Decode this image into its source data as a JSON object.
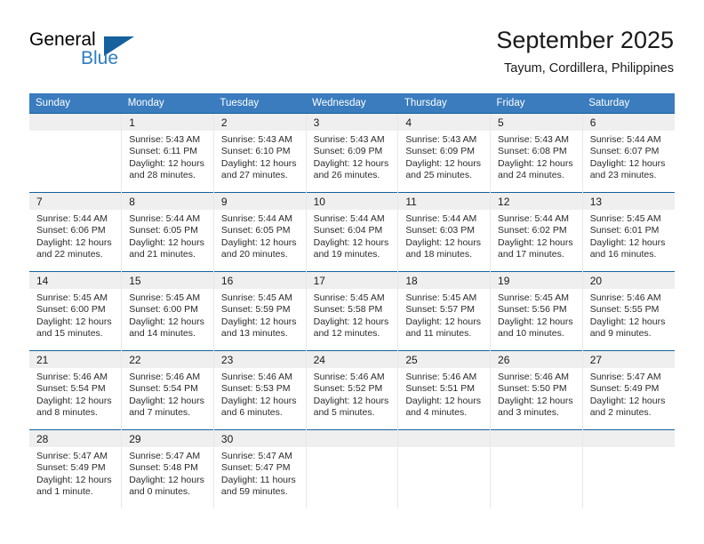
{
  "brand": {
    "name_part1": "General",
    "name_part2": "Blue",
    "logo_icon": "triangle-logo-icon",
    "color_primary": "#15619e",
    "color_secondary": "#2e7dc0"
  },
  "header": {
    "title": "September 2025",
    "subtitle": "Tayum, Cordillera, Philippines"
  },
  "theme": {
    "header_row_bg": "#3a7cbe",
    "day_band_bg": "#efefef",
    "row_divider": "#15619e",
    "column_divider": "#e8e8e8"
  },
  "calendar": {
    "weekday_headers": [
      "Sunday",
      "Monday",
      "Tuesday",
      "Wednesday",
      "Thursday",
      "Friday",
      "Saturday"
    ],
    "weeks": [
      [
        {
          "day": "",
          "sunrise": "",
          "sunset": "",
          "daylight_line1": "",
          "daylight_line2": "",
          "empty": true
        },
        {
          "day": "1",
          "sunrise": "Sunrise: 5:43 AM",
          "sunset": "Sunset: 6:11 PM",
          "daylight_line1": "Daylight: 12 hours",
          "daylight_line2": "and 28 minutes.",
          "empty": false
        },
        {
          "day": "2",
          "sunrise": "Sunrise: 5:43 AM",
          "sunset": "Sunset: 6:10 PM",
          "daylight_line1": "Daylight: 12 hours",
          "daylight_line2": "and 27 minutes.",
          "empty": false
        },
        {
          "day": "3",
          "sunrise": "Sunrise: 5:43 AM",
          "sunset": "Sunset: 6:09 PM",
          "daylight_line1": "Daylight: 12 hours",
          "daylight_line2": "and 26 minutes.",
          "empty": false
        },
        {
          "day": "4",
          "sunrise": "Sunrise: 5:43 AM",
          "sunset": "Sunset: 6:09 PM",
          "daylight_line1": "Daylight: 12 hours",
          "daylight_line2": "and 25 minutes.",
          "empty": false
        },
        {
          "day": "5",
          "sunrise": "Sunrise: 5:43 AM",
          "sunset": "Sunset: 6:08 PM",
          "daylight_line1": "Daylight: 12 hours",
          "daylight_line2": "and 24 minutes.",
          "empty": false
        },
        {
          "day": "6",
          "sunrise": "Sunrise: 5:44 AM",
          "sunset": "Sunset: 6:07 PM",
          "daylight_line1": "Daylight: 12 hours",
          "daylight_line2": "and 23 minutes.",
          "empty": false
        }
      ],
      [
        {
          "day": "7",
          "sunrise": "Sunrise: 5:44 AM",
          "sunset": "Sunset: 6:06 PM",
          "daylight_line1": "Daylight: 12 hours",
          "daylight_line2": "and 22 minutes.",
          "empty": false
        },
        {
          "day": "8",
          "sunrise": "Sunrise: 5:44 AM",
          "sunset": "Sunset: 6:05 PM",
          "daylight_line1": "Daylight: 12 hours",
          "daylight_line2": "and 21 minutes.",
          "empty": false
        },
        {
          "day": "9",
          "sunrise": "Sunrise: 5:44 AM",
          "sunset": "Sunset: 6:05 PM",
          "daylight_line1": "Daylight: 12 hours",
          "daylight_line2": "and 20 minutes.",
          "empty": false
        },
        {
          "day": "10",
          "sunrise": "Sunrise: 5:44 AM",
          "sunset": "Sunset: 6:04 PM",
          "daylight_line1": "Daylight: 12 hours",
          "daylight_line2": "and 19 minutes.",
          "empty": false
        },
        {
          "day": "11",
          "sunrise": "Sunrise: 5:44 AM",
          "sunset": "Sunset: 6:03 PM",
          "daylight_line1": "Daylight: 12 hours",
          "daylight_line2": "and 18 minutes.",
          "empty": false
        },
        {
          "day": "12",
          "sunrise": "Sunrise: 5:44 AM",
          "sunset": "Sunset: 6:02 PM",
          "daylight_line1": "Daylight: 12 hours",
          "daylight_line2": "and 17 minutes.",
          "empty": false
        },
        {
          "day": "13",
          "sunrise": "Sunrise: 5:45 AM",
          "sunset": "Sunset: 6:01 PM",
          "daylight_line1": "Daylight: 12 hours",
          "daylight_line2": "and 16 minutes.",
          "empty": false
        }
      ],
      [
        {
          "day": "14",
          "sunrise": "Sunrise: 5:45 AM",
          "sunset": "Sunset: 6:00 PM",
          "daylight_line1": "Daylight: 12 hours",
          "daylight_line2": "and 15 minutes.",
          "empty": false
        },
        {
          "day": "15",
          "sunrise": "Sunrise: 5:45 AM",
          "sunset": "Sunset: 6:00 PM",
          "daylight_line1": "Daylight: 12 hours",
          "daylight_line2": "and 14 minutes.",
          "empty": false
        },
        {
          "day": "16",
          "sunrise": "Sunrise: 5:45 AM",
          "sunset": "Sunset: 5:59 PM",
          "daylight_line1": "Daylight: 12 hours",
          "daylight_line2": "and 13 minutes.",
          "empty": false
        },
        {
          "day": "17",
          "sunrise": "Sunrise: 5:45 AM",
          "sunset": "Sunset: 5:58 PM",
          "daylight_line1": "Daylight: 12 hours",
          "daylight_line2": "and 12 minutes.",
          "empty": false
        },
        {
          "day": "18",
          "sunrise": "Sunrise: 5:45 AM",
          "sunset": "Sunset: 5:57 PM",
          "daylight_line1": "Daylight: 12 hours",
          "daylight_line2": "and 11 minutes.",
          "empty": false
        },
        {
          "day": "19",
          "sunrise": "Sunrise: 5:45 AM",
          "sunset": "Sunset: 5:56 PM",
          "daylight_line1": "Daylight: 12 hours",
          "daylight_line2": "and 10 minutes.",
          "empty": false
        },
        {
          "day": "20",
          "sunrise": "Sunrise: 5:46 AM",
          "sunset": "Sunset: 5:55 PM",
          "daylight_line1": "Daylight: 12 hours",
          "daylight_line2": "and 9 minutes.",
          "empty": false
        }
      ],
      [
        {
          "day": "21",
          "sunrise": "Sunrise: 5:46 AM",
          "sunset": "Sunset: 5:54 PM",
          "daylight_line1": "Daylight: 12 hours",
          "daylight_line2": "and 8 minutes.",
          "empty": false
        },
        {
          "day": "22",
          "sunrise": "Sunrise: 5:46 AM",
          "sunset": "Sunset: 5:54 PM",
          "daylight_line1": "Daylight: 12 hours",
          "daylight_line2": "and 7 minutes.",
          "empty": false
        },
        {
          "day": "23",
          "sunrise": "Sunrise: 5:46 AM",
          "sunset": "Sunset: 5:53 PM",
          "daylight_line1": "Daylight: 12 hours",
          "daylight_line2": "and 6 minutes.",
          "empty": false
        },
        {
          "day": "24",
          "sunrise": "Sunrise: 5:46 AM",
          "sunset": "Sunset: 5:52 PM",
          "daylight_line1": "Daylight: 12 hours",
          "daylight_line2": "and 5 minutes.",
          "empty": false
        },
        {
          "day": "25",
          "sunrise": "Sunrise: 5:46 AM",
          "sunset": "Sunset: 5:51 PM",
          "daylight_line1": "Daylight: 12 hours",
          "daylight_line2": "and 4 minutes.",
          "empty": false
        },
        {
          "day": "26",
          "sunrise": "Sunrise: 5:46 AM",
          "sunset": "Sunset: 5:50 PM",
          "daylight_line1": "Daylight: 12 hours",
          "daylight_line2": "and 3 minutes.",
          "empty": false
        },
        {
          "day": "27",
          "sunrise": "Sunrise: 5:47 AM",
          "sunset": "Sunset: 5:49 PM",
          "daylight_line1": "Daylight: 12 hours",
          "daylight_line2": "and 2 minutes.",
          "empty": false
        }
      ],
      [
        {
          "day": "28",
          "sunrise": "Sunrise: 5:47 AM",
          "sunset": "Sunset: 5:49 PM",
          "daylight_line1": "Daylight: 12 hours",
          "daylight_line2": "and 1 minute.",
          "empty": false
        },
        {
          "day": "29",
          "sunrise": "Sunrise: 5:47 AM",
          "sunset": "Sunset: 5:48 PM",
          "daylight_line1": "Daylight: 12 hours",
          "daylight_line2": "and 0 minutes.",
          "empty": false
        },
        {
          "day": "30",
          "sunrise": "Sunrise: 5:47 AM",
          "sunset": "Sunset: 5:47 PM",
          "daylight_line1": "Daylight: 11 hours",
          "daylight_line2": "and 59 minutes.",
          "empty": false
        },
        {
          "day": "",
          "sunrise": "",
          "sunset": "",
          "daylight_line1": "",
          "daylight_line2": "",
          "empty": true
        },
        {
          "day": "",
          "sunrise": "",
          "sunset": "",
          "daylight_line1": "",
          "daylight_line2": "",
          "empty": true
        },
        {
          "day": "",
          "sunrise": "",
          "sunset": "",
          "daylight_line1": "",
          "daylight_line2": "",
          "empty": true
        },
        {
          "day": "",
          "sunrise": "",
          "sunset": "",
          "daylight_line1": "",
          "daylight_line2": "",
          "empty": true
        }
      ]
    ]
  }
}
